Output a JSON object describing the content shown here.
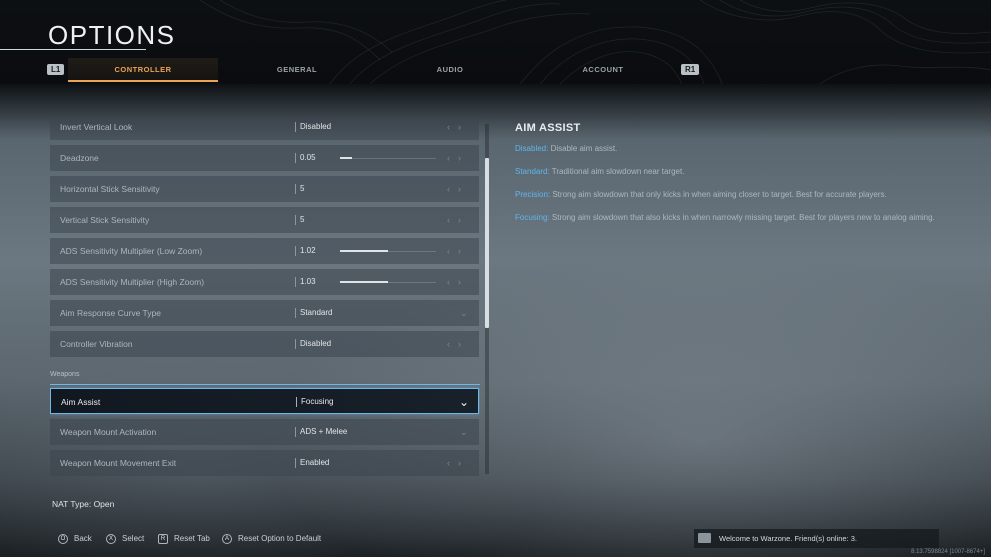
{
  "header": {
    "title": "OPTIONS",
    "left_bumper": "L1",
    "right_bumper": "R1",
    "tabs": [
      {
        "label": "CONTROLLER",
        "active": true
      },
      {
        "label": "GENERAL",
        "active": false
      },
      {
        "label": "AUDIO",
        "active": false
      },
      {
        "label": "ACCOUNT",
        "active": false
      }
    ]
  },
  "settings": {
    "rows": [
      {
        "label": "Invert Vertical Look",
        "value": "Disabled",
        "control": "arrows"
      },
      {
        "label": "Deadzone",
        "value": "0.05",
        "control": "slider",
        "level": 0.12
      },
      {
        "label": "Horizontal Stick Sensitivity",
        "value": "5",
        "control": "arrows"
      },
      {
        "label": "Vertical Stick Sensitivity",
        "value": "5",
        "control": "arrows"
      },
      {
        "label": "ADS Sensitivity Multiplier (Low Zoom)",
        "value": "1.02",
        "control": "slider",
        "level": 0.5
      },
      {
        "label": "ADS Sensitivity Multiplier (High Zoom)",
        "value": "1.03",
        "control": "slider",
        "level": 0.5
      },
      {
        "label": "Aim Response Curve Type",
        "value": "Standard",
        "control": "dropdown"
      },
      {
        "label": "Controller Vibration",
        "value": "Disabled",
        "control": "arrows"
      }
    ],
    "section_label": "Weapons",
    "weapon_rows": [
      {
        "label": "Aim Assist",
        "value": "Focusing",
        "control": "dropdown",
        "selected": true
      },
      {
        "label": "Weapon Mount Activation",
        "value": "ADS + Melee",
        "control": "dropdown"
      },
      {
        "label": "Weapon Mount Movement Exit",
        "value": "Enabled",
        "control": "arrows"
      }
    ]
  },
  "description": {
    "title": "AIM ASSIST",
    "items": [
      {
        "term": "Disabled:",
        "text": " Disable aim assist."
      },
      {
        "term": "Standard:",
        "text": " Traditional aim slowdown near target."
      },
      {
        "term": "Precision:",
        "text": " Strong aim slowdown that only kicks in when aiming closer to target.  Best for accurate players."
      },
      {
        "term": "Focusing:",
        "text": " Strong aim slowdown that also kicks in when narrowly missing target.  Best for players new to analog aiming."
      }
    ]
  },
  "nat_type": "NAT Type: Open",
  "footer": {
    "hints": [
      {
        "glyph": "O",
        "label": "Back"
      },
      {
        "glyph": "X",
        "label": "Select"
      },
      {
        "glyph": "R",
        "label": "Reset Tab"
      },
      {
        "glyph": "A",
        "label": "Reset Option to Default"
      }
    ],
    "message": "Welcome to Warzone. Friend(s) online: 3.",
    "version": "8.13.7598824 [1007-8674+]"
  },
  "colors": {
    "accent_orange": "#e8a455",
    "accent_blue": "#6fb7e6",
    "term_blue": "#5fb6ea"
  }
}
